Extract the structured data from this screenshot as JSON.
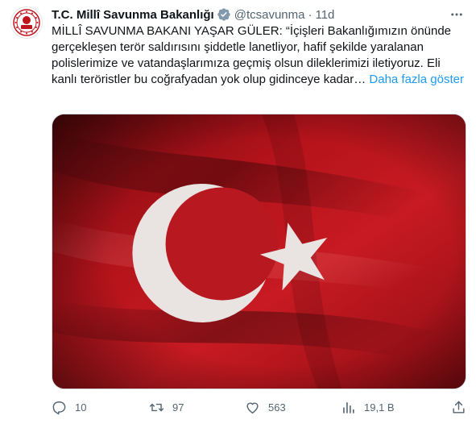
{
  "tweet": {
    "author": {
      "display_name": "T.C. Millî Savunma Bakanlığı",
      "handle": "@tcsavunma",
      "separator": "·",
      "time": "11d",
      "verified_icon": "verified-badge-icon"
    },
    "text": "MİLLÎ SAVUNMA BAKANI YAŞAR GÜLER: “İçişleri Bakanlığımızın önünde gerçekleşen terör saldırısını şiddetle lanetliyor, hafif şekilde yaralanan polislerimize ve vatandaşlarımıza geçmiş olsun dileklerimizi iletiyoruz. Eli kanlı teröristler bu coğrafyadan yok olup gidinceye kadar…",
    "show_more": "Daha fazla göster",
    "media": {
      "type": "image",
      "subject": "turkish-flag"
    },
    "actions": {
      "reply": {
        "icon": "reply-icon",
        "count": "10"
      },
      "retweet": {
        "icon": "retweet-icon",
        "count": "97"
      },
      "like": {
        "icon": "heart-icon",
        "count": "563"
      },
      "views": {
        "icon": "views-icon",
        "count": "19,1 B"
      },
      "share": {
        "icon": "share-icon"
      }
    }
  },
  "colors": {
    "link": "#1d9bf0",
    "secondary_text": "#536471",
    "flag_red": "#c0141c"
  }
}
